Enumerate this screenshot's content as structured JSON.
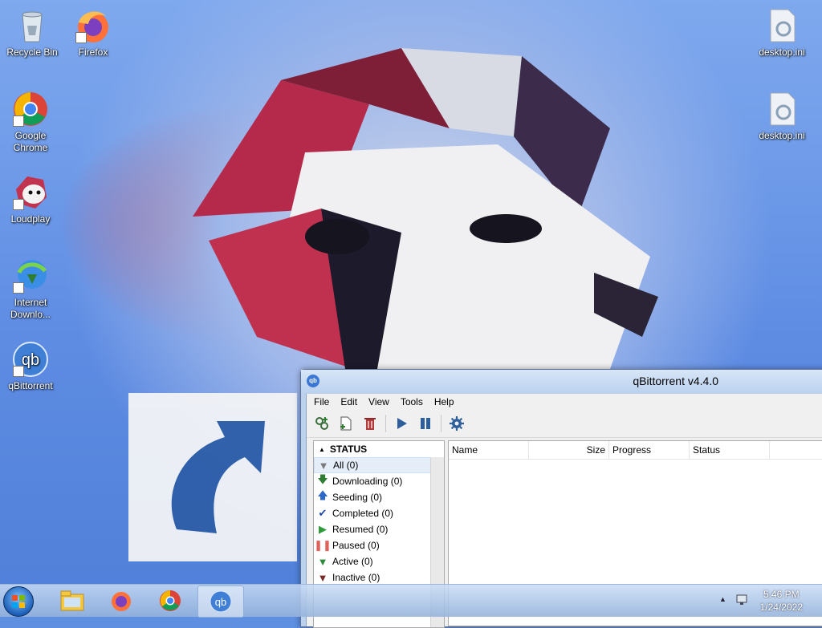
{
  "desktop": {
    "icons": [
      {
        "label": "Recycle Bin",
        "icon": "recycle-bin-icon"
      },
      {
        "label": "Firefox",
        "icon": "firefox-icon"
      },
      {
        "label": "Google Chrome",
        "icon": "chrome-icon"
      },
      {
        "label": "Loudplay",
        "icon": "loudplay-icon"
      },
      {
        "label": "Internet Downlo...",
        "icon": "internet-download-manager-icon"
      },
      {
        "label": "qBittorrent",
        "icon": "qbittorrent-icon"
      },
      {
        "label": "desktop.ini",
        "icon": "ini-file-icon"
      },
      {
        "label": "desktop.ini",
        "icon": "ini-file-icon"
      }
    ]
  },
  "window": {
    "title": "qBittorrent v4.4.0",
    "menu": [
      "File",
      "Edit",
      "View",
      "Tools",
      "Help"
    ],
    "toolbar": [
      "add-torrent-link-icon",
      "add-torrent-file-icon",
      "delete-icon",
      "resume-icon",
      "pause-icon",
      "options-gear-icon"
    ],
    "sidebar": {
      "header": "STATUS",
      "items": [
        {
          "label": "All (0)",
          "icon": "filter-all-icon",
          "color": "#7a7a7a"
        },
        {
          "label": "Downloading (0)",
          "icon": "download-arrow-icon",
          "color": "#2e7d32"
        },
        {
          "label": "Seeding (0)",
          "icon": "upload-arrow-icon",
          "color": "#2d67c8"
        },
        {
          "label": "Completed (0)",
          "icon": "check-icon",
          "color": "#1f4aa8"
        },
        {
          "label": "Resumed (0)",
          "icon": "play-icon",
          "color": "#2e9b3a"
        },
        {
          "label": "Paused (0)",
          "icon": "pause-icon",
          "color": "#e0615a"
        },
        {
          "label": "Active (0)",
          "icon": "filter-active-icon",
          "color": "#2e8b3a"
        },
        {
          "label": "Inactive (0)",
          "icon": "filter-inactive-icon",
          "color": "#7b2a2a"
        }
      ]
    },
    "columns": [
      "Name",
      "Size",
      "Progress",
      "Status"
    ]
  },
  "taskbar": {
    "apps": [
      "explorer-icon",
      "firefox-icon",
      "chrome-icon",
      "qbittorrent-icon"
    ],
    "time": "5:46 PM",
    "date": "1/24/2022"
  }
}
